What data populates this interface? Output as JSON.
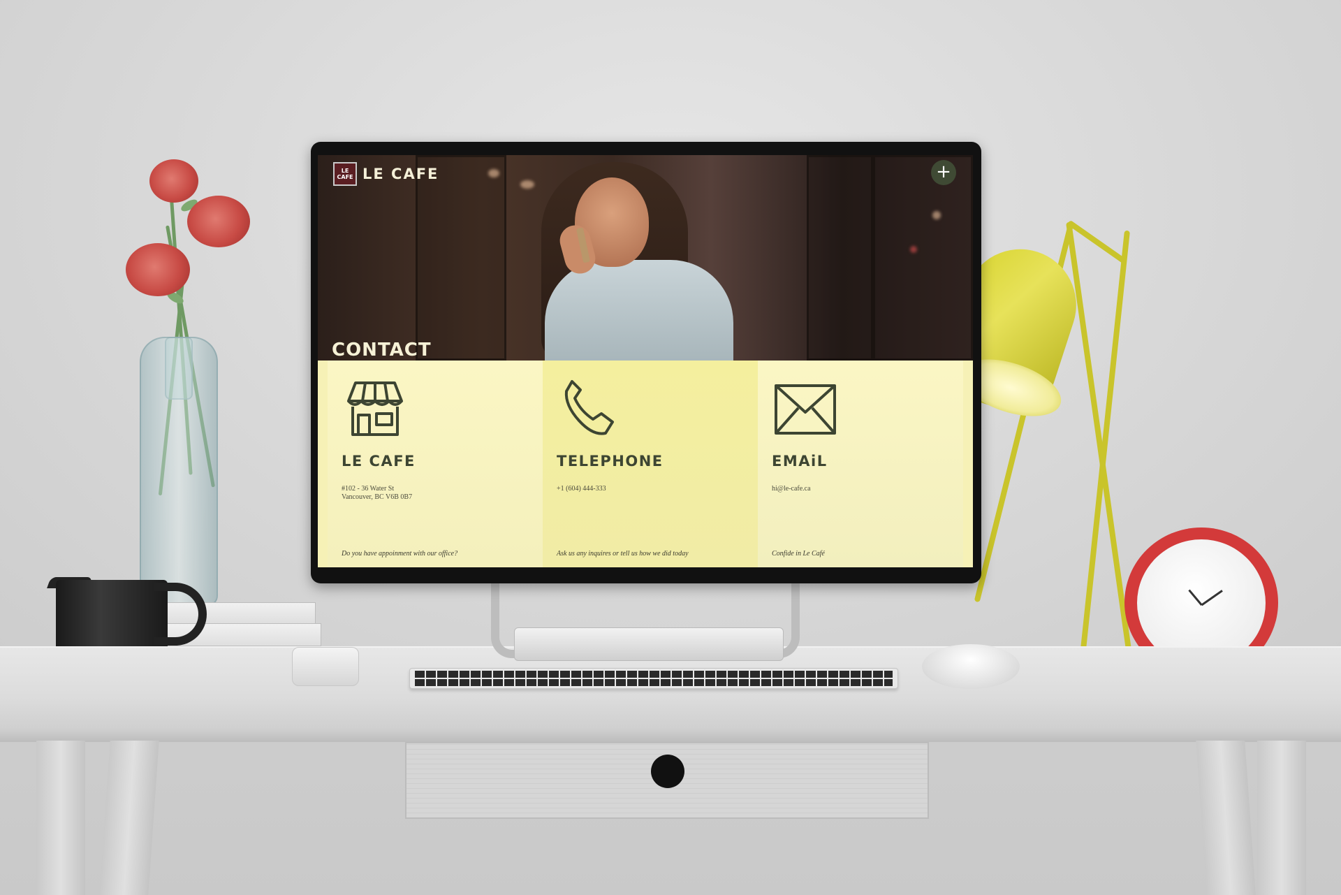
{
  "site": {
    "logo_mark_line1": "LE",
    "logo_mark_line2": "CAFE",
    "logo_text": "LE CAFE",
    "menu_label": "+",
    "page_title": "CONTACT"
  },
  "cards": [
    {
      "icon": "storefront-icon",
      "title": "LE CAFE",
      "detail_line1": "#102 - 36 Water St",
      "detail_line2": "Vancouver, BC V6B 0B7",
      "footer": "Do you have appoinment with our office?"
    },
    {
      "icon": "phone-icon",
      "title": "TELEPHONE",
      "detail_line1": "+1 (604) 444-333",
      "footer": "Ask us any inquires or tell us how we did today"
    },
    {
      "icon": "mail-icon",
      "title": "EMAiL",
      "detail_line1": "hi@le-cafe.ca",
      "footer": "Confide in Le Café"
    }
  ],
  "colors": {
    "card_bg": "#fbf6c4",
    "card_bg_alt": "#f4ef9e",
    "ink": "#3d4532",
    "menu_button": "#3f4a34",
    "logo_mark": "#5a1e22"
  }
}
